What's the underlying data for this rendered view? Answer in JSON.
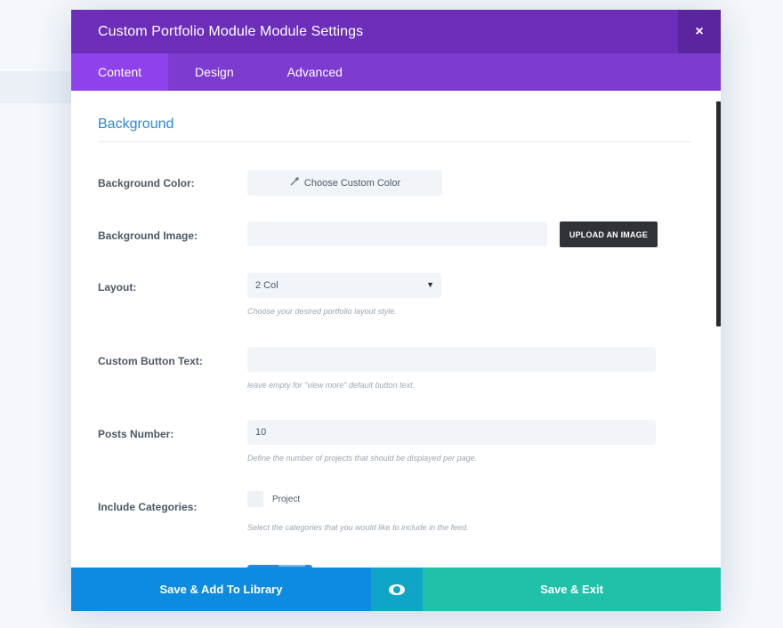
{
  "modal": {
    "title": "Custom Portfolio Module Module Settings",
    "close_label": "×"
  },
  "tabs": [
    {
      "label": "Content",
      "active": true
    },
    {
      "label": "Design",
      "active": false
    },
    {
      "label": "Advanced",
      "active": false
    }
  ],
  "section": {
    "title": "Background"
  },
  "fields": {
    "background_color": {
      "label": "Background Color:",
      "button": "Choose Custom Color"
    },
    "background_image": {
      "label": "Background Image:",
      "value": "",
      "upload": "UPLOAD AN IMAGE"
    },
    "layout": {
      "label": "Layout:",
      "selected": "2 Col",
      "help": "Choose your desired portfolio layout style."
    },
    "custom_button_text": {
      "label": "Custom Button Text:",
      "value": "",
      "help": "leave empty for \"view more\" default button text."
    },
    "posts_number": {
      "label": "Posts Number:",
      "value": "10",
      "help": "Define the number of projects that should be displayed per page."
    },
    "include_categories": {
      "label": "Include Categories:",
      "option": "Project",
      "checked": false,
      "help": "Select the categories that you would like to include in the feed."
    }
  },
  "footer": {
    "library": "Save & Add To Library",
    "save": "Save & Exit"
  },
  "colors": {
    "header": "#6c2eb9",
    "tabs": "#7e3bd0",
    "active_tab": "#8f42ec",
    "accent_blue": "#2b87da",
    "library_button": "#0c8be0",
    "preview_button": "#0ea5c6",
    "save_button": "#1fc1a8"
  },
  "icons": {
    "color_picker": "eyedropper-icon",
    "preview": "eye-icon",
    "close": "close-icon",
    "select_caret": "caret-down-icon"
  }
}
